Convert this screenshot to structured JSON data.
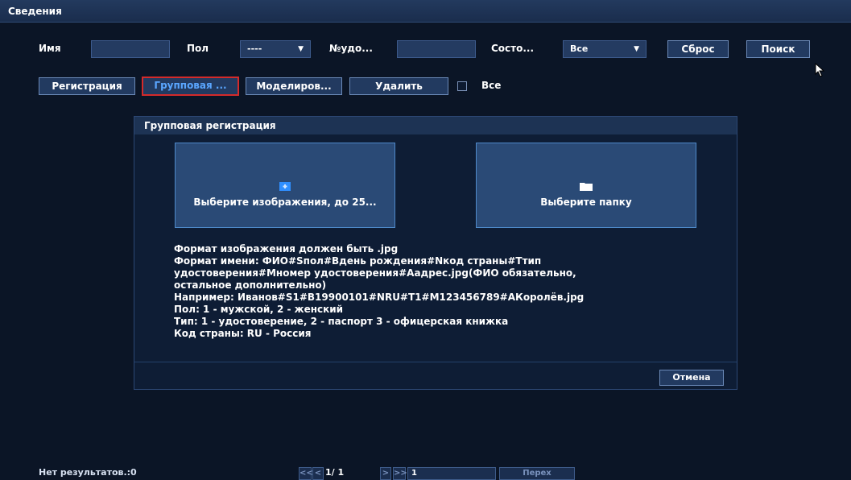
{
  "topbar": {
    "title": "Сведения"
  },
  "filters": {
    "name_label": "Имя",
    "gender_label": "Пол",
    "gender_value": "----",
    "id_label": "№удо...",
    "status_label": "Состо...",
    "status_value": "Все",
    "reset_label": "Сброс",
    "search_label": "Поиск"
  },
  "toolbar": {
    "register_label": "Регистрация",
    "batch_label": "Групповая ...",
    "model_label": "Моделиров...",
    "delete_label": "Удалить",
    "all_label": "Все"
  },
  "dialog": {
    "title": "Групповая регистрация",
    "select_images_label": "Выберите изображения, до 25...",
    "select_folder_label": "Выберите папку",
    "info_lines": [
      "Формат изображения должен быть .jpg",
      " Формат имени: ФИО#Sпол#Вдень рождения#Nкод страны#Ттип",
      "удостоверения#Мномер удостоверения#Аадрес.jpg(ФИО обязательно,",
      "остальное дополнительно)",
      "Например: Иванов#S1#B19900101#NRU#T1#M123456789#АКоролёв.jpg",
      "Пол: 1 - мужской, 2 - женский",
      "Тип: 1 - удостоверение, 2 - паспорт 3 - офицерская книжка",
      "Код страны: RU - Россия"
    ],
    "cancel_label": "Отмена"
  },
  "footer": {
    "results_label": "Нет результатов.:0",
    "page_indicator": "1/ 1",
    "page_input": "1",
    "goto_label": "Перех"
  },
  "colors": {
    "background": "#0b1526",
    "accent_blue": "#5aa6ff",
    "highlight_red": "#d42a2a"
  }
}
